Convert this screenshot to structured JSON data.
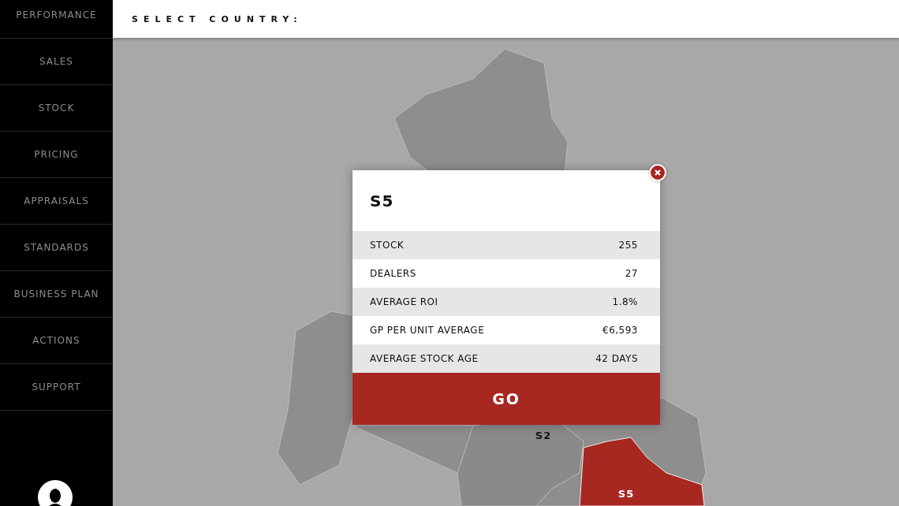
{
  "sidebar": {
    "items": [
      {
        "label": "PERFORMANCE",
        "selected": false
      },
      {
        "label": "SALES",
        "selected": false
      },
      {
        "label": "STOCK",
        "selected": false
      },
      {
        "label": "PRICING",
        "selected": false
      },
      {
        "label": "APPRAISALS",
        "selected": false
      },
      {
        "label": "STANDARDS",
        "selected": false
      },
      {
        "label": "BUSINESS PLAN",
        "selected": false
      },
      {
        "label": "ACTIONS",
        "selected": false
      },
      {
        "label": "SUPPORT",
        "selected": false
      }
    ]
  },
  "header": {
    "title": "SELECT COUNTRY:"
  },
  "map": {
    "regions": [
      {
        "label": "S2",
        "selected": false
      },
      {
        "label": "S5",
        "selected": true
      }
    ]
  },
  "popup": {
    "title": "S5",
    "rows": [
      {
        "label": "STOCK",
        "value": "255"
      },
      {
        "label": "DEALERS",
        "value": "27"
      },
      {
        "label": "AVERAGE ROI",
        "value": "1.8%"
      },
      {
        "label": "GP PER UNIT AVERAGE",
        "value": "€6,593"
      },
      {
        "label": "AVERAGE STOCK AGE",
        "value": "42 DAYS"
      }
    ],
    "button": "GO"
  }
}
